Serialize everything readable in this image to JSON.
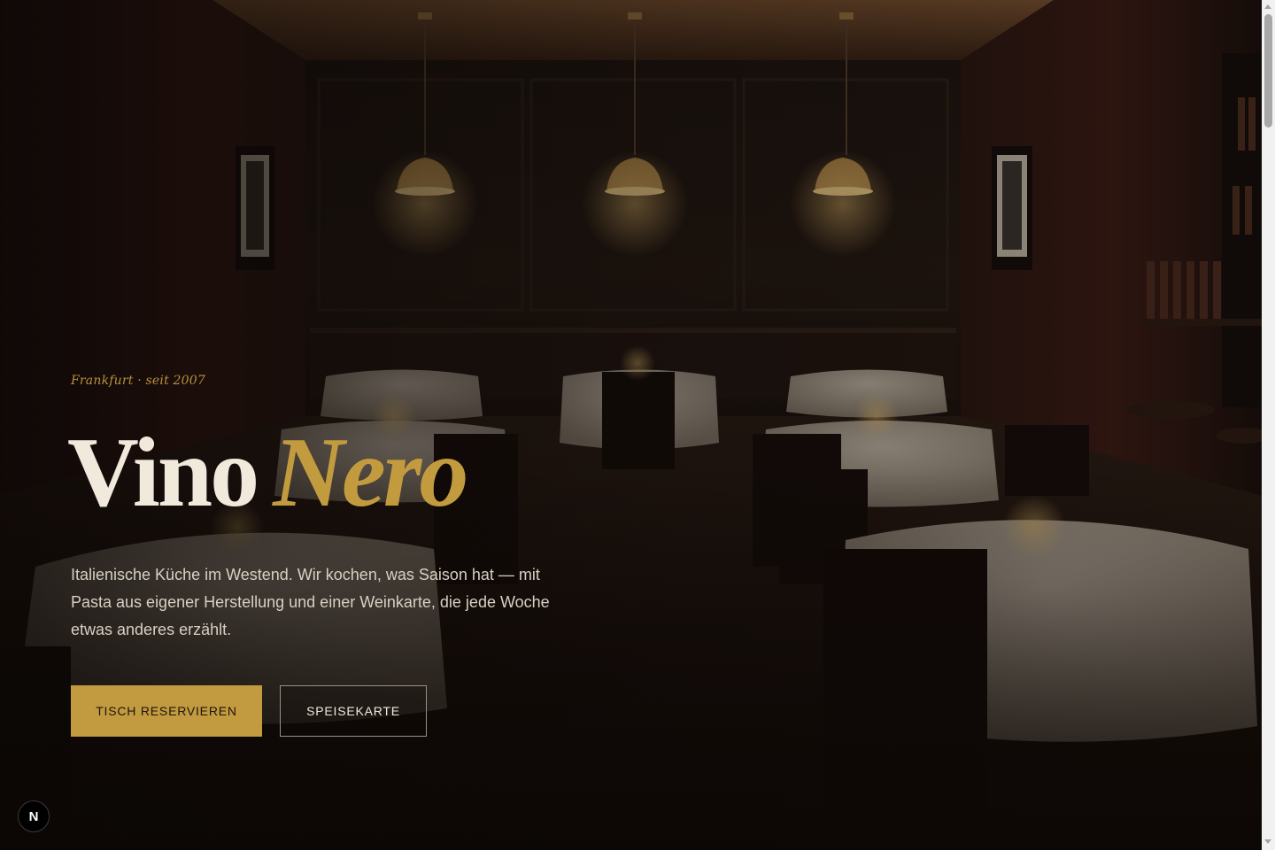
{
  "hero": {
    "eyebrow": "Frankfurt · seit 2007",
    "title_main": "Vino",
    "title_accent": "Nero",
    "lead": "Italienische Küche im Westend. Wir kochen, was Saison hat — mit Pasta aus eigener Herstellung und einer Weinkarte, die jede Woche etwas anderes erzählt.",
    "primary_cta": "TISCH RESERVIEREN",
    "secondary_cta": "SPEISEKARTE"
  },
  "dev_badge": "N",
  "colors": {
    "accent_gold": "#c29a3f",
    "text_light": "#f1e9dc",
    "background_dark": "#0f0a08"
  },
  "icons": {
    "dev_badge": "nextjs-logo-icon",
    "scroll_up": "arrow-up-icon",
    "scroll_down": "arrow-down-icon"
  }
}
